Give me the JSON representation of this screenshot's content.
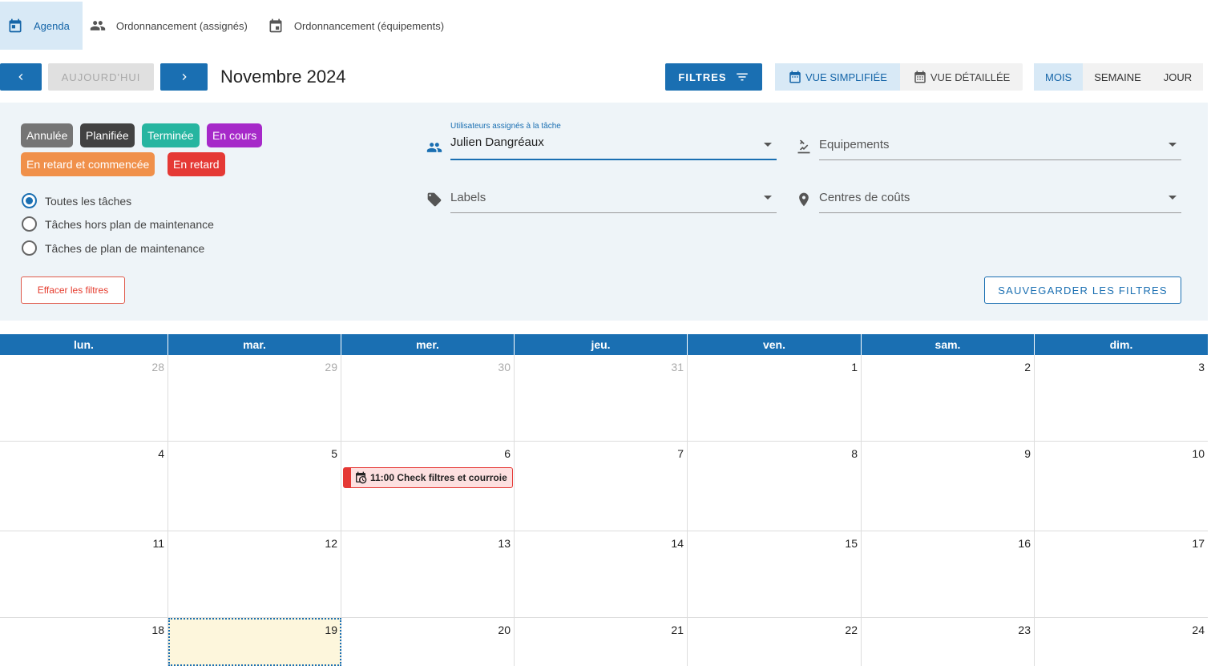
{
  "tabs": [
    {
      "label": "Agenda",
      "icon": "calendar-icon",
      "active": true
    },
    {
      "label": "Ordonnancement (assignés)",
      "icon": "users-icon",
      "active": false
    },
    {
      "label": "Ordonnancement (équipements)",
      "icon": "calendar-outline-icon",
      "active": false
    }
  ],
  "toolbar": {
    "today_label": "AUJOURD'HUI",
    "month_title": "Novembre 2024",
    "filters_label": "FILTRES",
    "view_simple_label": "VUE SIMPLIFIÉE",
    "view_detailed_label": "VUE DÉTAILLÉE",
    "period_month": "MOIS",
    "period_week": "SEMAINE",
    "period_day": "JOUR"
  },
  "status_chips": [
    {
      "label": "Annulée",
      "color": "#757575"
    },
    {
      "label": "Planifiée",
      "color": "#424242"
    },
    {
      "label": "Terminée",
      "color": "#26b5a0"
    },
    {
      "label": "En cours",
      "color": "#a629c9"
    },
    {
      "label": "En retard et commencée",
      "color": "#f0904a"
    },
    {
      "label": "En retard",
      "color": "#e53935"
    }
  ],
  "task_filter": {
    "options": [
      "Toutes les tâches",
      "Tâches hors plan de maintenance",
      "Tâches de plan de maintenance"
    ],
    "selected": "Toutes les tâches"
  },
  "fields": {
    "assigned": {
      "label": "Utilisateurs assignés à la tâche",
      "value": "Julien Dangréaux"
    },
    "equipments": {
      "placeholder": "Equipements"
    },
    "labels": {
      "placeholder": "Labels"
    },
    "cost_centers": {
      "placeholder": "Centres de coûts"
    }
  },
  "clear_filters_label": "Effacer les filtres",
  "save_filters_label": "SAUVEGARDER LES FILTRES",
  "calendar": {
    "weekdays": [
      "lun.",
      "mar.",
      "mer.",
      "jeu.",
      "ven.",
      "sam.",
      "dim."
    ],
    "weeks": [
      [
        "28",
        "29",
        "30",
        "31",
        "1",
        "2",
        "3"
      ],
      [
        "4",
        "5",
        "6",
        "7",
        "8",
        "9",
        "10"
      ],
      [
        "11",
        "12",
        "13",
        "14",
        "15",
        "16",
        "17"
      ],
      [
        "18",
        "19",
        "20",
        "21",
        "22",
        "23",
        "24"
      ]
    ],
    "today": "19",
    "event": {
      "day": "6",
      "text": "11:00 Check filtres et courroie"
    }
  },
  "colors": {
    "primary": "#1a6fb2",
    "active_bg": "#d8e9f6",
    "panel_bg": "#eef4f8",
    "today_bg": "#fdf6dc",
    "danger": "#e53935"
  }
}
